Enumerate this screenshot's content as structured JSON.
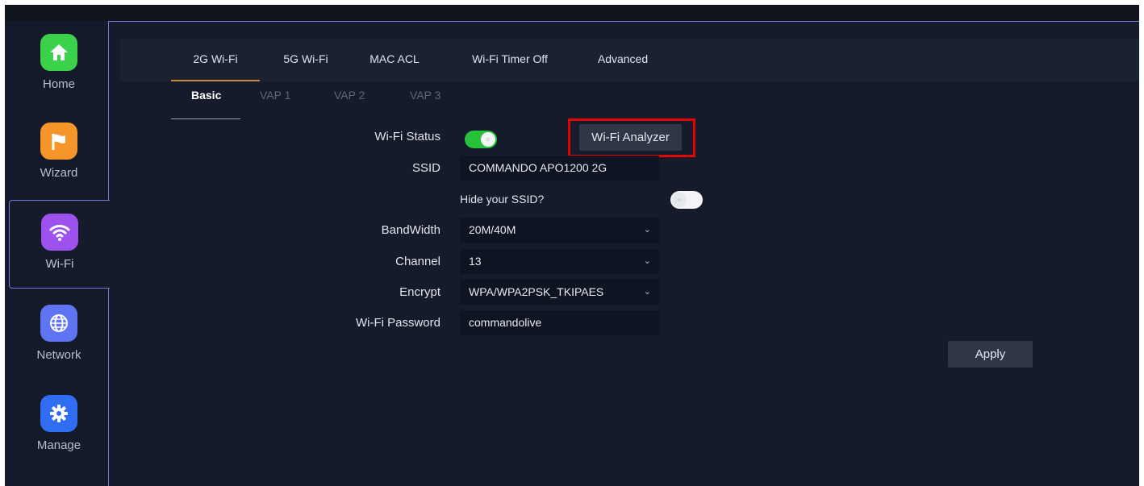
{
  "sidebar": {
    "items": [
      {
        "label": "Home",
        "icon": "home-icon",
        "color": "#3bd14a"
      },
      {
        "label": "Wizard",
        "icon": "flag-icon",
        "color": "#f5952a"
      },
      {
        "label": "Wi-Fi",
        "icon": "wifi-icon",
        "color": "#9d52f0",
        "active": true
      },
      {
        "label": "Network",
        "icon": "globe-icon",
        "color": "#5f74f2"
      },
      {
        "label": "Manage",
        "icon": "gear-icon",
        "color": "#2f6ef2"
      }
    ]
  },
  "tabs": [
    {
      "label": "2G Wi-Fi",
      "active": true
    },
    {
      "label": "5G Wi-Fi"
    },
    {
      "label": "MAC ACL"
    },
    {
      "label": "Wi-Fi Timer Off"
    },
    {
      "label": "Advanced"
    }
  ],
  "subtabs": [
    {
      "label": "Basic",
      "active": true
    },
    {
      "label": "VAP 1"
    },
    {
      "label": "VAP 2"
    },
    {
      "label": "VAP 3"
    }
  ],
  "form": {
    "wifi_status_label": "Wi-Fi Status",
    "wifi_status_on": true,
    "analyzer_button": "Wi-Fi Analyzer",
    "ssid_label": "SSID",
    "ssid_value": "COMMANDO APO1200 2G",
    "hide_ssid_label": "Hide your SSID?",
    "hide_ssid_on": false,
    "bandwidth_label": "BandWidth",
    "bandwidth_value": "20M/40M",
    "channel_label": "Channel",
    "channel_value": "13",
    "encrypt_label": "Encrypt",
    "encrypt_value": "WPA/WPA2PSK_TKIPAES",
    "password_label": "Wi-Fi Password",
    "password_value": "commandolive",
    "apply_button": "Apply"
  },
  "colors": {
    "accent_tab": "#c8893a",
    "toggle_on": "#27c13c",
    "highlight": "#e50000"
  }
}
